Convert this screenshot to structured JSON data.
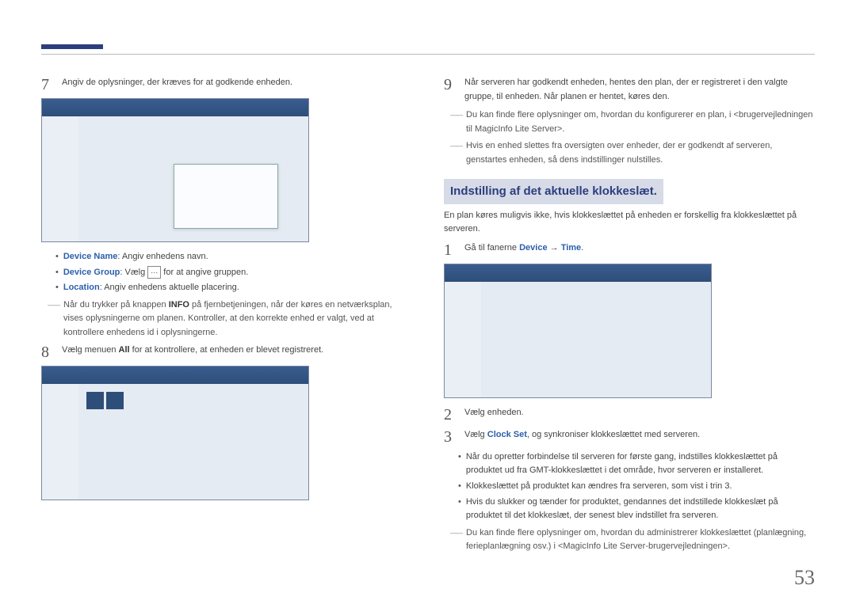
{
  "pageNumber": "53",
  "left": {
    "step7": {
      "num": "7",
      "text": "Angiv de oplysninger, der kræves for at godkende enheden."
    },
    "bullets": [
      {
        "label": "Device Name",
        "rest": ": Angiv enhedens navn."
      },
      {
        "label": "Device Group",
        "rest_before": ": Vælg ",
        "rest_after": " for at angive gruppen."
      },
      {
        "label": "Location",
        "rest": ": Angiv enhedens aktuelle placering."
      }
    ],
    "note7": {
      "prefix": "Når du trykker på knappen ",
      "bold": "INFO",
      "rest": " på fjernbetjeningen, når der køres en netværksplan, vises oplysningerne om planen. Kontroller, at den korrekte enhed er valgt, ved at kontrollere enhedens id i oplysningerne."
    },
    "step8": {
      "num": "8",
      "before": "Vælg menuen ",
      "bold": "All",
      "after": " for at kontrollere, at enheden er blevet registreret."
    }
  },
  "right": {
    "step9": {
      "num": "9",
      "text": "Når serveren har godkendt enheden, hentes den plan, der er registreret i den valgte gruppe, til enheden. Når planen er hentet, køres den."
    },
    "note9a": "Du kan finde flere oplysninger om, hvordan du konfigurerer en plan, i <brugervejledningen til MagicInfo Lite Server>.",
    "note9b": "Hvis en enhed slettes fra oversigten over enheder, der er godkendt af serveren, genstartes enheden, så dens indstillinger nulstilles.",
    "heading": "Indstilling af det aktuelle klokkeslæt.",
    "intro": "En plan køres muligvis ikke, hvis klokkeslættet på enheden er forskellig fra klokkeslættet på serveren.",
    "step1": {
      "num": "1",
      "before": "Gå til fanerne ",
      "blue1": "Device",
      "arrow": " → ",
      "blue2": "Time",
      "after": "."
    },
    "step2": {
      "num": "2",
      "text": "Vælg enheden."
    },
    "step3": {
      "num": "3",
      "before": "Vælg ",
      "blue": "Clock Set",
      "after": ", og synkroniser klokkeslættet med serveren."
    },
    "subbullets": [
      "Når du opretter forbindelse til serveren for første gang, indstilles klokkeslættet på produktet ud fra GMT-klokkeslættet i det område, hvor serveren er installeret.",
      "Klokkeslættet på produktet kan ændres fra serveren, som vist i trin 3.",
      "Hvis du slukker og tænder for produktet, gendannes det indstillede klokkeslæt på produktet til det klokkeslæt, der senest blev indstillet fra serveren."
    ],
    "noteEnd": "Du kan finde flere oplysninger om, hvordan du administrerer klokkeslættet (planlægning, ferieplanlægning osv.) i <MagicInfo Lite Server-brugervejledningen>."
  }
}
